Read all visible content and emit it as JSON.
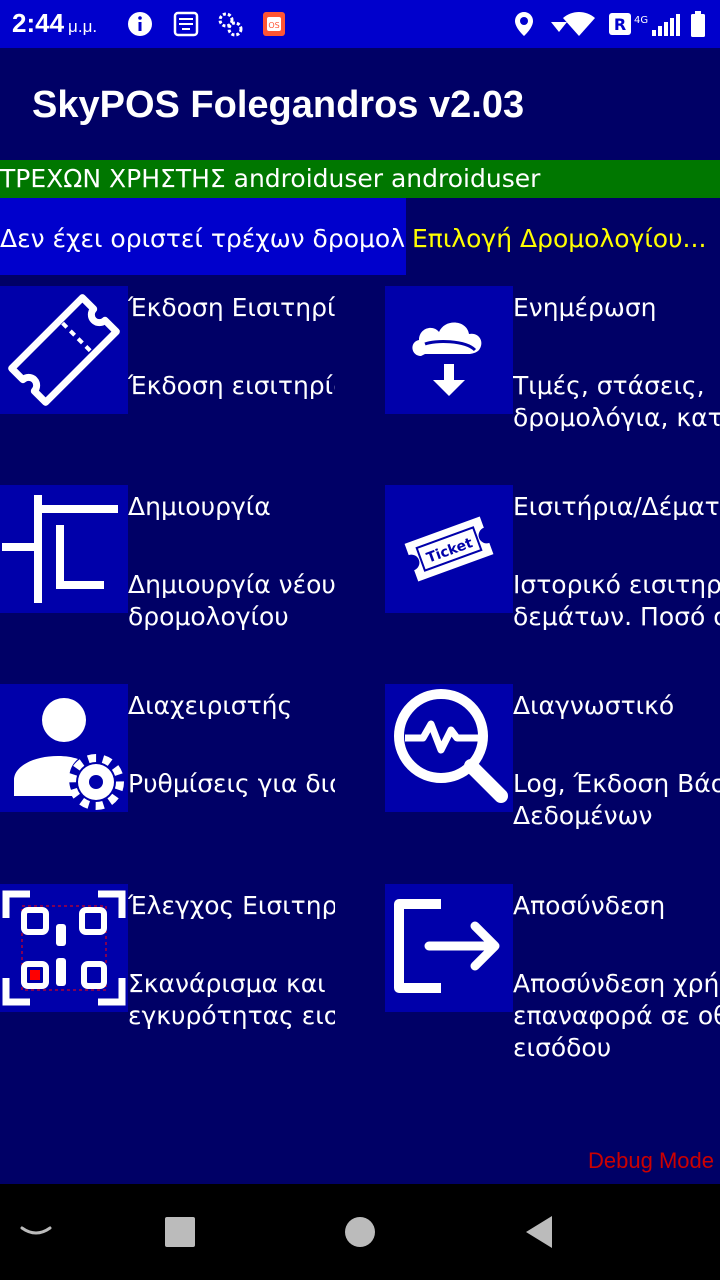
{
  "status_bar": {
    "time": "2:44",
    "ampm": "μ.μ.",
    "icons": [
      "info-icon",
      "storefront-icon",
      "settings-gears-icon",
      "app-badge-icon",
      "location-icon",
      "data-arrow-icon",
      "wifi-icon",
      "roaming-icon",
      "signal-4g-icon",
      "battery-icon"
    ]
  },
  "app": {
    "title": "SkyPOS Folegandros v2.03"
  },
  "user_bar": {
    "text": "ΤΡΕΧΩΝ ΧΡΗΣΤΗΣ androiduser androiduser",
    "color": "#007700"
  },
  "route_bar": {
    "current": "Δεν έχει οριστεί τρέχων δρομολόγιο",
    "select": "Επιλογή Δρομολογίου...",
    "select_color": "#ffff00"
  },
  "tiles": [
    {
      "title": "Έκδοση Εισιτηρίων",
      "desc": "Έκδοση εισιτηρίων",
      "icon": "ticket-outline-icon"
    },
    {
      "title": "Ενημέρωση",
      "desc": "Τιμές, στάσεις,\nδρομολόγια, κατηγορίες",
      "icon": "cloud-download-icon"
    },
    {
      "title": "Δημιουργία",
      "desc": "Δημιουργία νέου\nδρομολογίου",
      "icon": "route-icon"
    },
    {
      "title": "Εισιτήρια/Δέματα",
      "desc": "Ιστορικό εισιτηρίων και\nδεμάτων. Ποσό συνόλου",
      "icon": "ticket-icon"
    },
    {
      "title": "Διαχειριστής",
      "desc": "Ρυθμίσεις για διαχειριστή",
      "icon": "user-settings-icon"
    },
    {
      "title": "Διαγνωστικό",
      "desc": "Log, Έκδοση Βάσης\nΔεδομένων",
      "icon": "diagnostic-search-icon"
    },
    {
      "title": "Έλεγχος Εισιτηρίων",
      "desc": "Σκανάρισμα και έλεγχος\nεγκυρότητας εισιτηρίου",
      "icon": "qr-scan-icon"
    },
    {
      "title": "Αποσύνδεση",
      "desc": "Αποσύνδεση χρήστη και\nεπαναφορά σε οθόνη\nεισόδου",
      "icon": "logout-icon"
    }
  ],
  "debug_label": "Debug Mode",
  "nav": [
    "back-chevron-icon",
    "home-circle-icon",
    "overview-square-icon",
    "back-triangle-icon"
  ]
}
